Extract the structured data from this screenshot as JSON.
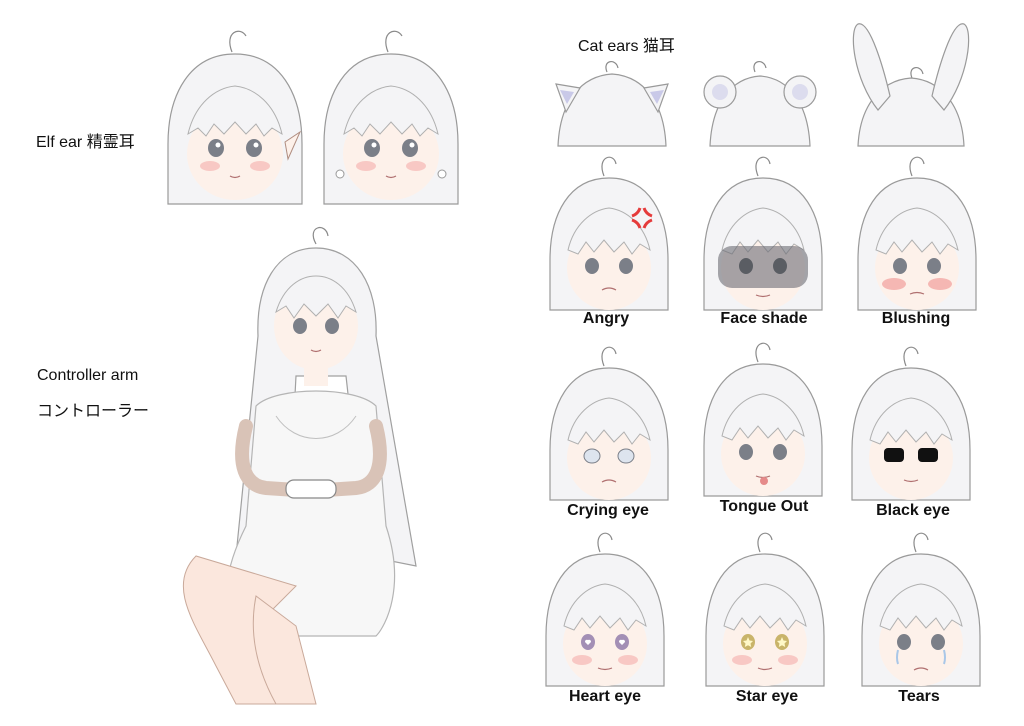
{
  "labels": {
    "elf_ear": "Elf ear 精霊耳",
    "cat_ears": "Cat ears 猫耳",
    "controller_arm_en": "Controller arm",
    "controller_arm_jp": "コントローラー"
  },
  "expressions": [
    "Angry",
    "Face shade",
    "Blushing",
    "Crying eye",
    "Tongue Out",
    "Black eye",
    "Heart eye",
    "Star eye",
    "Tears"
  ],
  "colors": {
    "hair": "#f4f4f6",
    "outline": "#8a8a8a",
    "skin": "#fdf1ea",
    "blush": "#f5b7b3",
    "eye": "#7b7f88",
    "anger": "#e53b3b"
  }
}
